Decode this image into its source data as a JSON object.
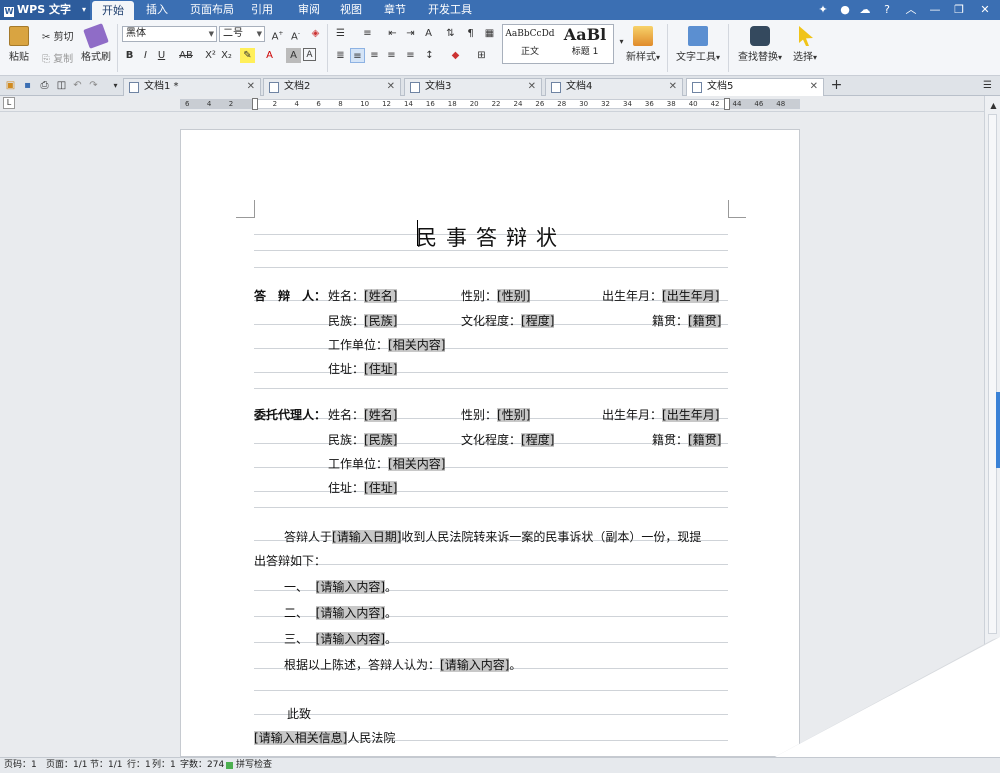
{
  "app": {
    "name": "WPS 文字"
  },
  "menu": {
    "tabs": [
      "开始",
      "插入",
      "页面布局",
      "引用",
      "审阅",
      "视图",
      "章节",
      "开发工具"
    ],
    "help": "?"
  },
  "ribbon": {
    "paste": "粘贴",
    "cut": "剪切",
    "copy": "复制",
    "format_painter": "格式刷",
    "font_name": "黑体",
    "font_size": "二号",
    "style_normal_preview": "AaBbCcDd",
    "style_normal": "正文",
    "style_heading_preview": "AaBl",
    "style_heading": "标题 1",
    "new_style": "新样式",
    "text_tools": "文字工具",
    "find_replace": "查找替换",
    "select": "选择"
  },
  "doc_tabs": [
    "文档1 *",
    "文档2",
    "文档3",
    "文档4",
    "文档5"
  ],
  "ruler": {
    "labels": [
      "6",
      "4",
      "2",
      "",
      "2",
      "4",
      "6",
      "8",
      "10",
      "12",
      "14",
      "16",
      "18",
      "20",
      "22",
      "24",
      "26",
      "28",
      "30",
      "32",
      "34",
      "36",
      "38",
      "40",
      "42",
      "44",
      "46",
      "48"
    ]
  },
  "document": {
    "title": "民事答辩状",
    "defendant_label": "答　辩　人：",
    "agent_label": "委托代理人：",
    "name_label": "姓名：",
    "name_field": "[姓名]",
    "gender_label": "性别：",
    "gender_field": "[性别]",
    "birth_label": "出生年月：",
    "birth_field": "[出生年月]",
    "ethnic_label": "民族：",
    "ethnic_field": "[民族]",
    "edu_label": "文化程度：",
    "edu_field": "[程度]",
    "origin_label": "籍贯：",
    "origin_field": "[籍贯]",
    "work_label": "工作单位：",
    "work_field": "[相关内容]",
    "address_label": "住址：",
    "address_field": "[住址]",
    "para1_a": "答辩人于",
    "para1_field": "[请输入日期]",
    "para1_b": "收到人民法院转来诉一案的民事诉状（副本）一份，现提",
    "para1_c": "出答辩如下：",
    "items": [
      {
        "num": "一、",
        "field": "[请输入内容]",
        "end": "。"
      },
      {
        "num": "二、",
        "field": "[请输入内容]",
        "end": "。"
      },
      {
        "num": "三、",
        "field": "[请输入内容]",
        "end": "。"
      }
    ],
    "conclusion_a": "根据以上陈述，答辩人认为：",
    "conclusion_field": "[请输入内容]",
    "conclusion_end": "。",
    "regards": "此致",
    "court_field": "[请输入相关信息]",
    "court_text": "人民法院"
  },
  "status": {
    "page_num": "页码：1",
    "pages": "页面：1/1",
    "section": "节：1/1",
    "row": "行：1",
    "col": "列：1",
    "words": "字数：274",
    "spell": "拼写检查"
  }
}
